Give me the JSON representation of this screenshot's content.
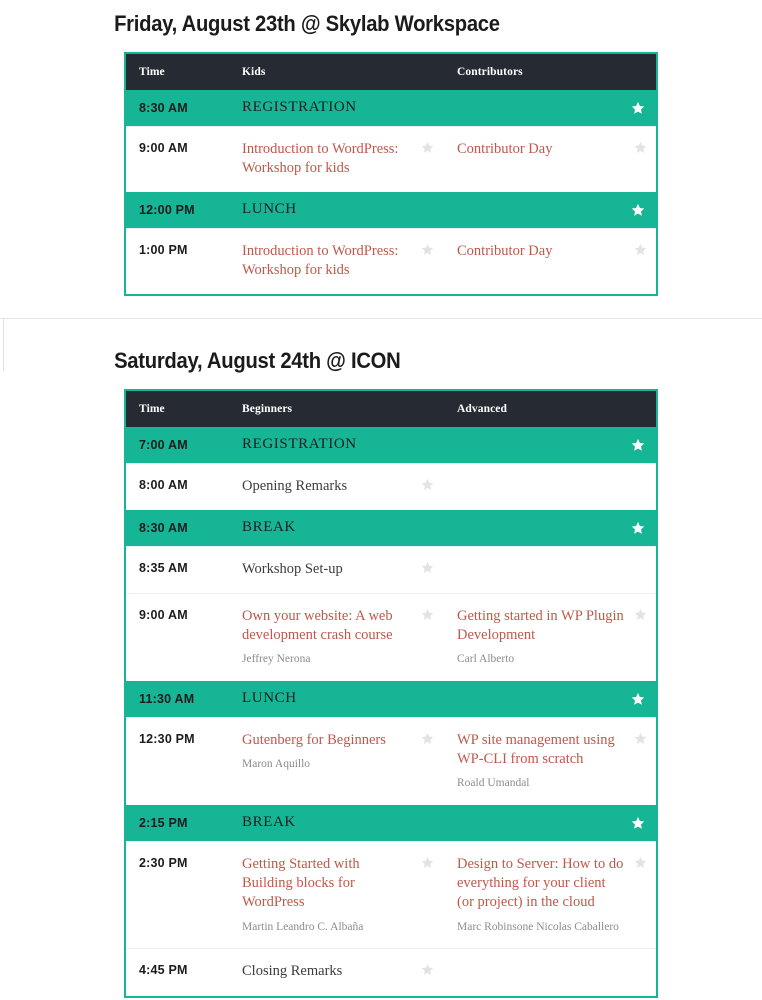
{
  "theme": {
    "accent_green": "#16b596",
    "header_dark": "#262b33",
    "link_red": "#c0584a",
    "speaker_gray": "#8c8c8c",
    "star_dim": "#e3e3e3",
    "star_bright": "#ffffff"
  },
  "icons": {
    "star": "star-icon"
  },
  "days": [
    {
      "title": "Friday, August 23th @ Skylab Workspace",
      "columns": [
        "Time",
        "Kids",
        "Contributors"
      ],
      "rows": [
        {
          "type": "global",
          "time": "8:30 AM",
          "title": "REGISTRATION",
          "star": "bright"
        },
        {
          "type": "session",
          "time": "9:00 AM",
          "cells": [
            {
              "title": "Introduction to WordPress: Workshop for kids",
              "speaker": "",
              "link": true,
              "star": "dim"
            },
            {
              "title": "Contributor Day",
              "speaker": "",
              "link": true,
              "star": "dim"
            }
          ]
        },
        {
          "type": "global",
          "time": "12:00 PM",
          "title": "LUNCH",
          "star": "bright"
        },
        {
          "type": "session",
          "time": "1:00 PM",
          "cells": [
            {
              "title": "Introduction to WordPress: Workshop for kids",
              "speaker": "",
              "link": true,
              "star": "dim"
            },
            {
              "title": "Contributor Day",
              "speaker": "",
              "link": true,
              "star": "dim"
            }
          ]
        }
      ]
    },
    {
      "title": "Saturday, August 24th @ ICON",
      "columns": [
        "Time",
        "Beginners",
        "Advanced"
      ],
      "rows": [
        {
          "type": "global",
          "time": "7:00 AM",
          "title": "REGISTRATION",
          "star": "bright"
        },
        {
          "type": "session",
          "time": "8:00 AM",
          "cells": [
            {
              "title": "Opening Remarks",
              "speaker": "",
              "link": false,
              "star": "dim"
            },
            {
              "title": "",
              "speaker": "",
              "link": false,
              "star": ""
            }
          ]
        },
        {
          "type": "global",
          "time": "8:30 AM",
          "title": "BREAK",
          "star": "bright"
        },
        {
          "type": "session",
          "time": "8:35 AM",
          "cells": [
            {
              "title": "Workshop Set-up",
              "speaker": "",
              "link": false,
              "star": "dim"
            },
            {
              "title": "",
              "speaker": "",
              "link": false,
              "star": ""
            }
          ]
        },
        {
          "type": "session",
          "time": "9:00 AM",
          "cells": [
            {
              "title": "Own your website: A web development crash course",
              "speaker": "Jeffrey Nerona",
              "link": true,
              "star": "dim"
            },
            {
              "title": "Getting started in WP Plugin Development",
              "speaker": "Carl Alberto",
              "link": true,
              "star": "dim"
            }
          ]
        },
        {
          "type": "global",
          "time": "11:30 AM",
          "title": "LUNCH",
          "star": "bright"
        },
        {
          "type": "session",
          "time": "12:30 PM",
          "cells": [
            {
              "title": "Gutenberg for Beginners",
              "speaker": "Maron Aquillo",
              "link": true,
              "star": "dim"
            },
            {
              "title": "WP site management using WP-CLI from scratch",
              "speaker": "Roald Umandal",
              "link": true,
              "star": "dim"
            }
          ]
        },
        {
          "type": "global",
          "time": "2:15 PM",
          "title": "BREAK",
          "star": "bright"
        },
        {
          "type": "session",
          "time": "2:30 PM",
          "cells": [
            {
              "title": "Getting Started with Building blocks for WordPress",
              "speaker": "Martin Leandro C. Albaña",
              "link": true,
              "star": "dim"
            },
            {
              "title": "Design to Server: How to do everything for your client (or project) in the cloud",
              "speaker": "Marc Robinsone Nicolas Caballero",
              "link": true,
              "star": "dim"
            }
          ]
        },
        {
          "type": "session",
          "time": "4:45 PM",
          "cells": [
            {
              "title": "Closing Remarks",
              "speaker": "",
              "link": false,
              "star": "dim"
            },
            {
              "title": "",
              "speaker": "",
              "link": false,
              "star": ""
            }
          ]
        }
      ]
    }
  ]
}
